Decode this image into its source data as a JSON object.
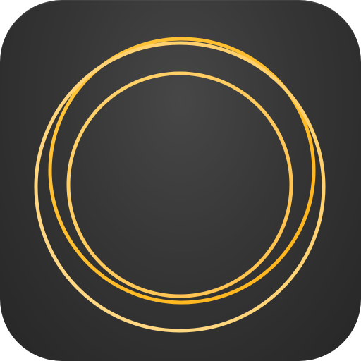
{
  "icon": {
    "name": "rings-app-icon",
    "background_color": "#333333",
    "ring_colors": [
      "#FFB81C",
      "#FFC845",
      "#FFD27A"
    ]
  }
}
